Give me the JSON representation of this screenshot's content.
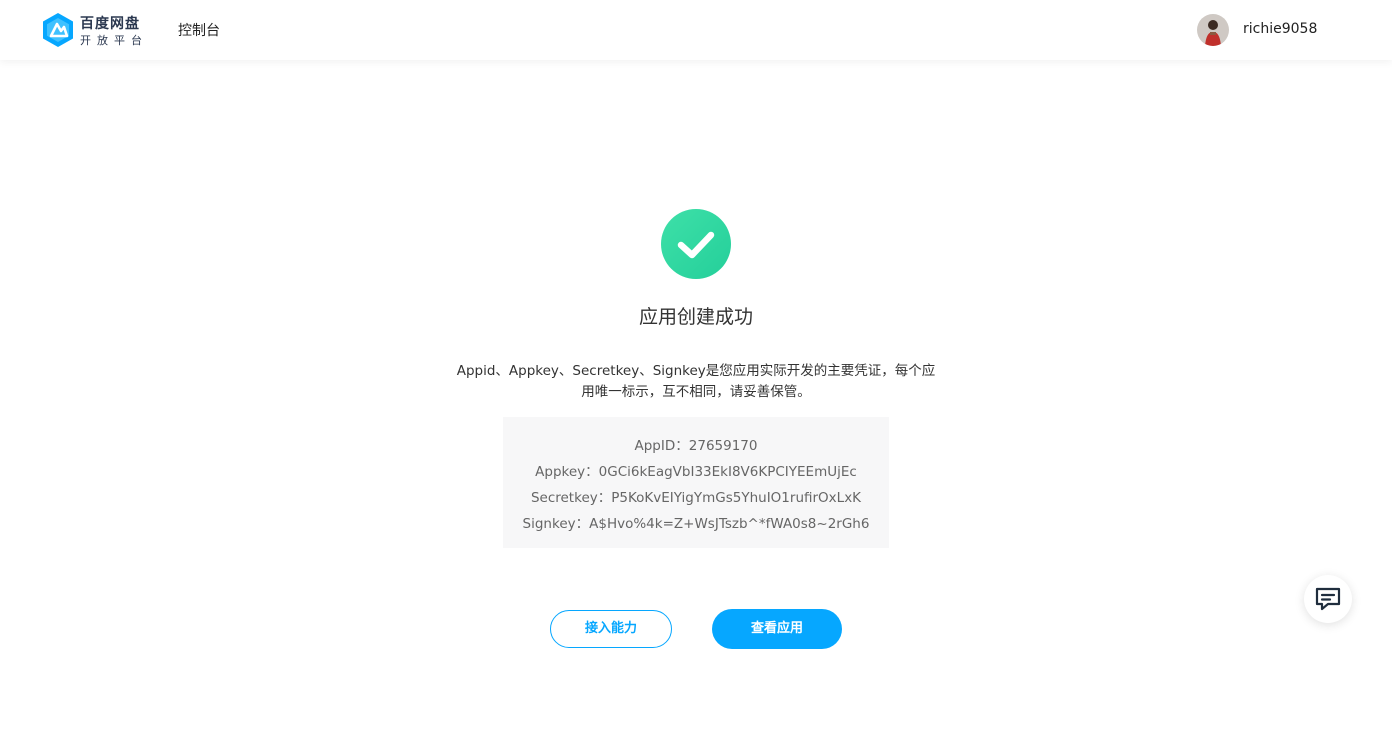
{
  "header": {
    "logo": {
      "name": "百度网盘",
      "subtitle": "开放平台",
      "brand_color": "#06a7ff"
    },
    "nav": {
      "console_label": "控制台"
    },
    "user": {
      "username": "richie9058"
    }
  },
  "main": {
    "status_icon": "check-circle-icon",
    "status_color": "#34d7a3",
    "title": "应用创建成功",
    "description": "Appid、Appkey、Secretkey、Signkey是您应用实际开发的主要凭证，每个应用唯一标示，互不相同，请妥善保管。",
    "credentials": [
      {
        "label": "AppID：",
        "value": "27659170"
      },
      {
        "label": "Appkey：",
        "value": "0GCi6kEagVbI33EkI8V6KPCIYEEmUjEc"
      },
      {
        "label": "Secretkey：",
        "value": "P5KoKvEIYigYmGs5YhuIO1rufirOxLxK"
      },
      {
        "label": "Signkey：",
        "value": "A$Hvo%4k=Z+WsJTszb^*fWA0s8~2rGh6"
      }
    ],
    "buttons": {
      "integrate_label": "接入能力",
      "view_app_label": "查看应用"
    }
  },
  "floating": {
    "chat_icon": "chat-bubble-icon"
  }
}
